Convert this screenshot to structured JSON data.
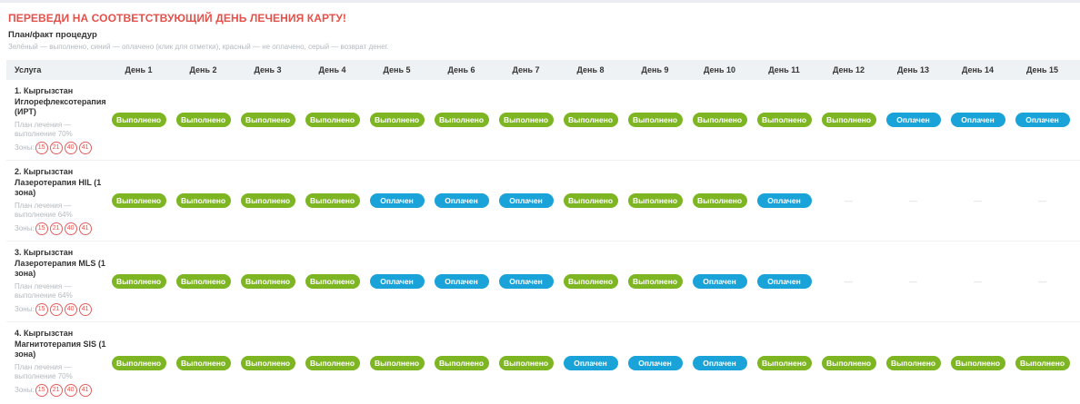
{
  "alert": "ПЕРЕВЕДИ НА СООТВЕТСТВУЮЩИЙ ДЕНЬ ЛЕЧЕНИЯ КАРТУ!",
  "subtitle": "План/факт процедур",
  "legend": "Зелёный — выполнено, синий — оплачено (клик для отметки), красный — не оплачено, серый — возврат денег.",
  "header": {
    "service": "Услуга",
    "days": [
      "День 1",
      "День 2",
      "День 3",
      "День 4",
      "День 5",
      "День 6",
      "День 7",
      "День 8",
      "День 9",
      "День 10",
      "День 11",
      "День 12",
      "День 13",
      "День 14",
      "День 15"
    ]
  },
  "zones_label": "Зоны:",
  "status_labels": {
    "done": "Выполнено",
    "paid": "Оплачен",
    "none": "—"
  },
  "colors": {
    "done": "#7eb623",
    "paid": "#1aa3d9",
    "alert": "#e5504a"
  },
  "rows": [
    {
      "name": "1. Кыргызстан Иглорефлексотерапия (ИРТ)",
      "plan": "План лечения — выполнение 70%",
      "zones": [
        "15",
        "21",
        "40",
        "41"
      ],
      "days": [
        "done",
        "done",
        "done",
        "done",
        "done",
        "done",
        "done",
        "done",
        "done",
        "done",
        "done",
        "done",
        "paid",
        "paid",
        "paid"
      ]
    },
    {
      "name": "2. Кыргызстан Лазеротерапия HIL (1 зона)",
      "plan": "План лечения — выполнение 64%",
      "zones": [
        "15",
        "21",
        "40",
        "41"
      ],
      "days": [
        "done",
        "done",
        "done",
        "done",
        "paid",
        "paid",
        "paid",
        "done",
        "done",
        "done",
        "paid",
        "none",
        "none",
        "none",
        "none"
      ]
    },
    {
      "name": "3. Кыргызстан Лазеротерапия MLS (1 зона)",
      "plan": "План лечения — выполнение 64%",
      "zones": [
        "15",
        "21",
        "40",
        "41"
      ],
      "days": [
        "done",
        "done",
        "done",
        "done",
        "paid",
        "paid",
        "paid",
        "done",
        "done",
        "paid",
        "paid",
        "none",
        "none",
        "none",
        "none"
      ]
    },
    {
      "name": "4. Кыргызстан Магнитотерапия SIS (1 зона)",
      "plan": "План лечения — выполнение 70%",
      "zones": [
        "15",
        "21",
        "40",
        "41"
      ],
      "days": [
        "done",
        "done",
        "done",
        "done",
        "done",
        "done",
        "done",
        "paid",
        "paid",
        "paid",
        "done",
        "done",
        "done",
        "done",
        "done"
      ]
    }
  ]
}
